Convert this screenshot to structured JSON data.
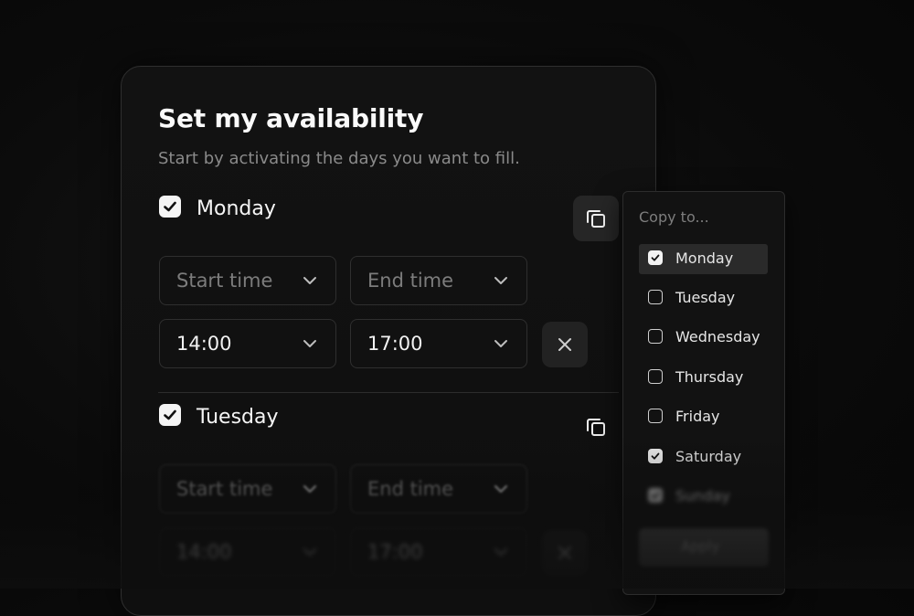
{
  "panel": {
    "title": "Set my availability",
    "subtitle": "Start by activating the days you want to fill."
  },
  "days": [
    {
      "label": "Monday",
      "checked": true,
      "rows": [
        {
          "start": "Start time",
          "end": "End time",
          "placeholder": true
        },
        {
          "start": "14:00",
          "end": "17:00",
          "placeholder": false
        }
      ]
    },
    {
      "label": "Tuesday",
      "checked": true,
      "rows": [
        {
          "start": "Start time",
          "end": "End time",
          "placeholder": true
        },
        {
          "start": "14:00",
          "end": "17:00",
          "placeholder": false
        }
      ]
    }
  ],
  "copy_menu": {
    "title": "Copy to...",
    "items": [
      {
        "label": "Monday",
        "checked": true,
        "selected": true
      },
      {
        "label": "Tuesday",
        "checked": false
      },
      {
        "label": "Wednesday",
        "checked": false
      },
      {
        "label": "Thursday",
        "checked": false
      },
      {
        "label": "Friday",
        "checked": false
      },
      {
        "label": "Saturday",
        "checked": true
      },
      {
        "label": "Sunday",
        "checked": true
      }
    ],
    "apply_label": "Apply"
  }
}
